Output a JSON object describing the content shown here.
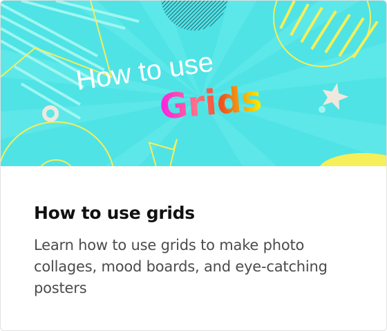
{
  "card": {
    "image": {
      "headline": "How to use",
      "highlight": "Grids",
      "background_color": "#4fe3e6",
      "accent_color": "#f5ef5a"
    },
    "title": "How to use grids",
    "description": "Learn how to use grids to make photo collages, mood boards, and eye-catching posters"
  }
}
